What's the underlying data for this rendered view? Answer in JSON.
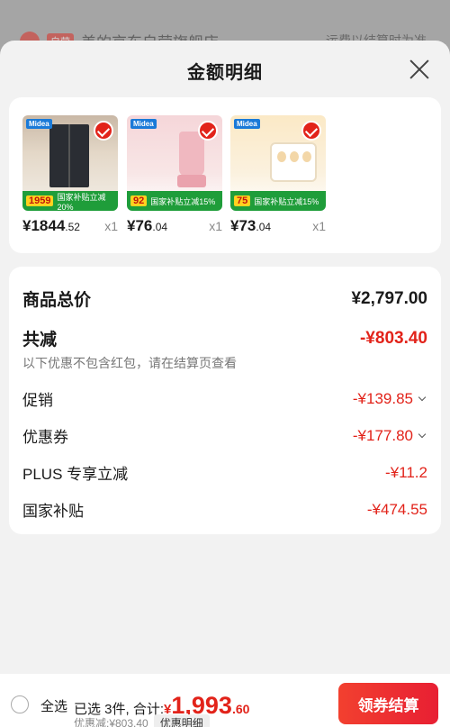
{
  "background": {
    "store_badge": "自营",
    "store_name": "美的京东自营旗舰店 ›",
    "shipping_note": "运费以结算时为准"
  },
  "sheet": {
    "title": "金额明细"
  },
  "products": [
    {
      "name": "refrigerator",
      "logo": "Midea",
      "promo_price": "1959",
      "promo_text": "国家补贴立减20%",
      "price_int": "¥1844",
      "price_dec": ".52",
      "qty": "x1"
    },
    {
      "name": "blender",
      "logo": "Midea",
      "promo_price": "92",
      "promo_text": "国家补贴立减15%",
      "price_int": "¥76",
      "price_dec": ".04",
      "qty": "x1"
    },
    {
      "name": "egg-cooker",
      "logo": "Midea",
      "promo_price": "75",
      "promo_text": "国家补贴立减15%",
      "price_int": "¥73",
      "price_dec": ".04",
      "qty": "x1"
    }
  ],
  "summary": {
    "total_label": "商品总价",
    "total_value": "¥2,797.00",
    "reduce_label": "共减",
    "reduce_value": "-¥803.40",
    "note": "以下优惠不包含红包，请在结算页查看",
    "promo_label": "促销",
    "promo_value": "-¥139.85",
    "coupon_label": "优惠券",
    "coupon_value": "-¥177.80",
    "plus_label": "PLUS 专享立减",
    "plus_value": "-¥11.2",
    "subsidy_label": "国家补贴",
    "subsidy_value": "-¥474.55"
  },
  "bottom": {
    "select_all": "全选",
    "selected_text": "已选 3件, 合计:",
    "currency": "¥",
    "total_int": "1,993",
    "total_dec": ".60",
    "discount_text": "优惠减:¥803.40",
    "detail_tag": "优惠明细",
    "checkout": "领券结算"
  },
  "colors": {
    "accent": "#e2231a",
    "promo_green": "#1f9d3a"
  }
}
